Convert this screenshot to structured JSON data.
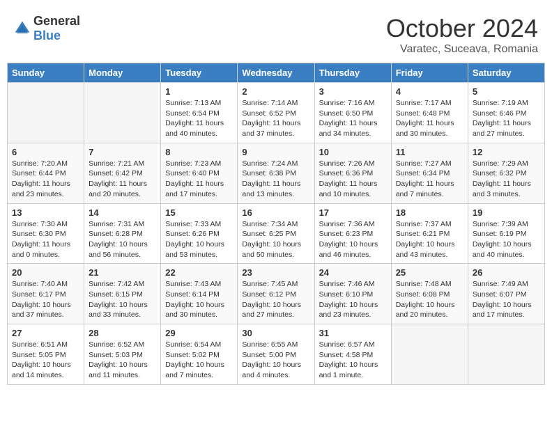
{
  "logo": {
    "general": "General",
    "blue": "Blue"
  },
  "header": {
    "month": "October 2024",
    "location": "Varatec, Suceava, Romania"
  },
  "weekdays": [
    "Sunday",
    "Monday",
    "Tuesday",
    "Wednesday",
    "Thursday",
    "Friday",
    "Saturday"
  ],
  "weeks": [
    [
      {
        "day": "",
        "info": ""
      },
      {
        "day": "",
        "info": ""
      },
      {
        "day": "1",
        "info": "Sunrise: 7:13 AM\nSunset: 6:54 PM\nDaylight: 11 hours and 40 minutes."
      },
      {
        "day": "2",
        "info": "Sunrise: 7:14 AM\nSunset: 6:52 PM\nDaylight: 11 hours and 37 minutes."
      },
      {
        "day": "3",
        "info": "Sunrise: 7:16 AM\nSunset: 6:50 PM\nDaylight: 11 hours and 34 minutes."
      },
      {
        "day": "4",
        "info": "Sunrise: 7:17 AM\nSunset: 6:48 PM\nDaylight: 11 hours and 30 minutes."
      },
      {
        "day": "5",
        "info": "Sunrise: 7:19 AM\nSunset: 6:46 PM\nDaylight: 11 hours and 27 minutes."
      }
    ],
    [
      {
        "day": "6",
        "info": "Sunrise: 7:20 AM\nSunset: 6:44 PM\nDaylight: 11 hours and 23 minutes."
      },
      {
        "day": "7",
        "info": "Sunrise: 7:21 AM\nSunset: 6:42 PM\nDaylight: 11 hours and 20 minutes."
      },
      {
        "day": "8",
        "info": "Sunrise: 7:23 AM\nSunset: 6:40 PM\nDaylight: 11 hours and 17 minutes."
      },
      {
        "day": "9",
        "info": "Sunrise: 7:24 AM\nSunset: 6:38 PM\nDaylight: 11 hours and 13 minutes."
      },
      {
        "day": "10",
        "info": "Sunrise: 7:26 AM\nSunset: 6:36 PM\nDaylight: 11 hours and 10 minutes."
      },
      {
        "day": "11",
        "info": "Sunrise: 7:27 AM\nSunset: 6:34 PM\nDaylight: 11 hours and 7 minutes."
      },
      {
        "day": "12",
        "info": "Sunrise: 7:29 AM\nSunset: 6:32 PM\nDaylight: 11 hours and 3 minutes."
      }
    ],
    [
      {
        "day": "13",
        "info": "Sunrise: 7:30 AM\nSunset: 6:30 PM\nDaylight: 11 hours and 0 minutes."
      },
      {
        "day": "14",
        "info": "Sunrise: 7:31 AM\nSunset: 6:28 PM\nDaylight: 10 hours and 56 minutes."
      },
      {
        "day": "15",
        "info": "Sunrise: 7:33 AM\nSunset: 6:26 PM\nDaylight: 10 hours and 53 minutes."
      },
      {
        "day": "16",
        "info": "Sunrise: 7:34 AM\nSunset: 6:25 PM\nDaylight: 10 hours and 50 minutes."
      },
      {
        "day": "17",
        "info": "Sunrise: 7:36 AM\nSunset: 6:23 PM\nDaylight: 10 hours and 46 minutes."
      },
      {
        "day": "18",
        "info": "Sunrise: 7:37 AM\nSunset: 6:21 PM\nDaylight: 10 hours and 43 minutes."
      },
      {
        "day": "19",
        "info": "Sunrise: 7:39 AM\nSunset: 6:19 PM\nDaylight: 10 hours and 40 minutes."
      }
    ],
    [
      {
        "day": "20",
        "info": "Sunrise: 7:40 AM\nSunset: 6:17 PM\nDaylight: 10 hours and 37 minutes."
      },
      {
        "day": "21",
        "info": "Sunrise: 7:42 AM\nSunset: 6:15 PM\nDaylight: 10 hours and 33 minutes."
      },
      {
        "day": "22",
        "info": "Sunrise: 7:43 AM\nSunset: 6:14 PM\nDaylight: 10 hours and 30 minutes."
      },
      {
        "day": "23",
        "info": "Sunrise: 7:45 AM\nSunset: 6:12 PM\nDaylight: 10 hours and 27 minutes."
      },
      {
        "day": "24",
        "info": "Sunrise: 7:46 AM\nSunset: 6:10 PM\nDaylight: 10 hours and 23 minutes."
      },
      {
        "day": "25",
        "info": "Sunrise: 7:48 AM\nSunset: 6:08 PM\nDaylight: 10 hours and 20 minutes."
      },
      {
        "day": "26",
        "info": "Sunrise: 7:49 AM\nSunset: 6:07 PM\nDaylight: 10 hours and 17 minutes."
      }
    ],
    [
      {
        "day": "27",
        "info": "Sunrise: 6:51 AM\nSunset: 5:05 PM\nDaylight: 10 hours and 14 minutes."
      },
      {
        "day": "28",
        "info": "Sunrise: 6:52 AM\nSunset: 5:03 PM\nDaylight: 10 hours and 11 minutes."
      },
      {
        "day": "29",
        "info": "Sunrise: 6:54 AM\nSunset: 5:02 PM\nDaylight: 10 hours and 7 minutes."
      },
      {
        "day": "30",
        "info": "Sunrise: 6:55 AM\nSunset: 5:00 PM\nDaylight: 10 hours and 4 minutes."
      },
      {
        "day": "31",
        "info": "Sunrise: 6:57 AM\nSunset: 4:58 PM\nDaylight: 10 hours and 1 minute."
      },
      {
        "day": "",
        "info": ""
      },
      {
        "day": "",
        "info": ""
      }
    ]
  ]
}
